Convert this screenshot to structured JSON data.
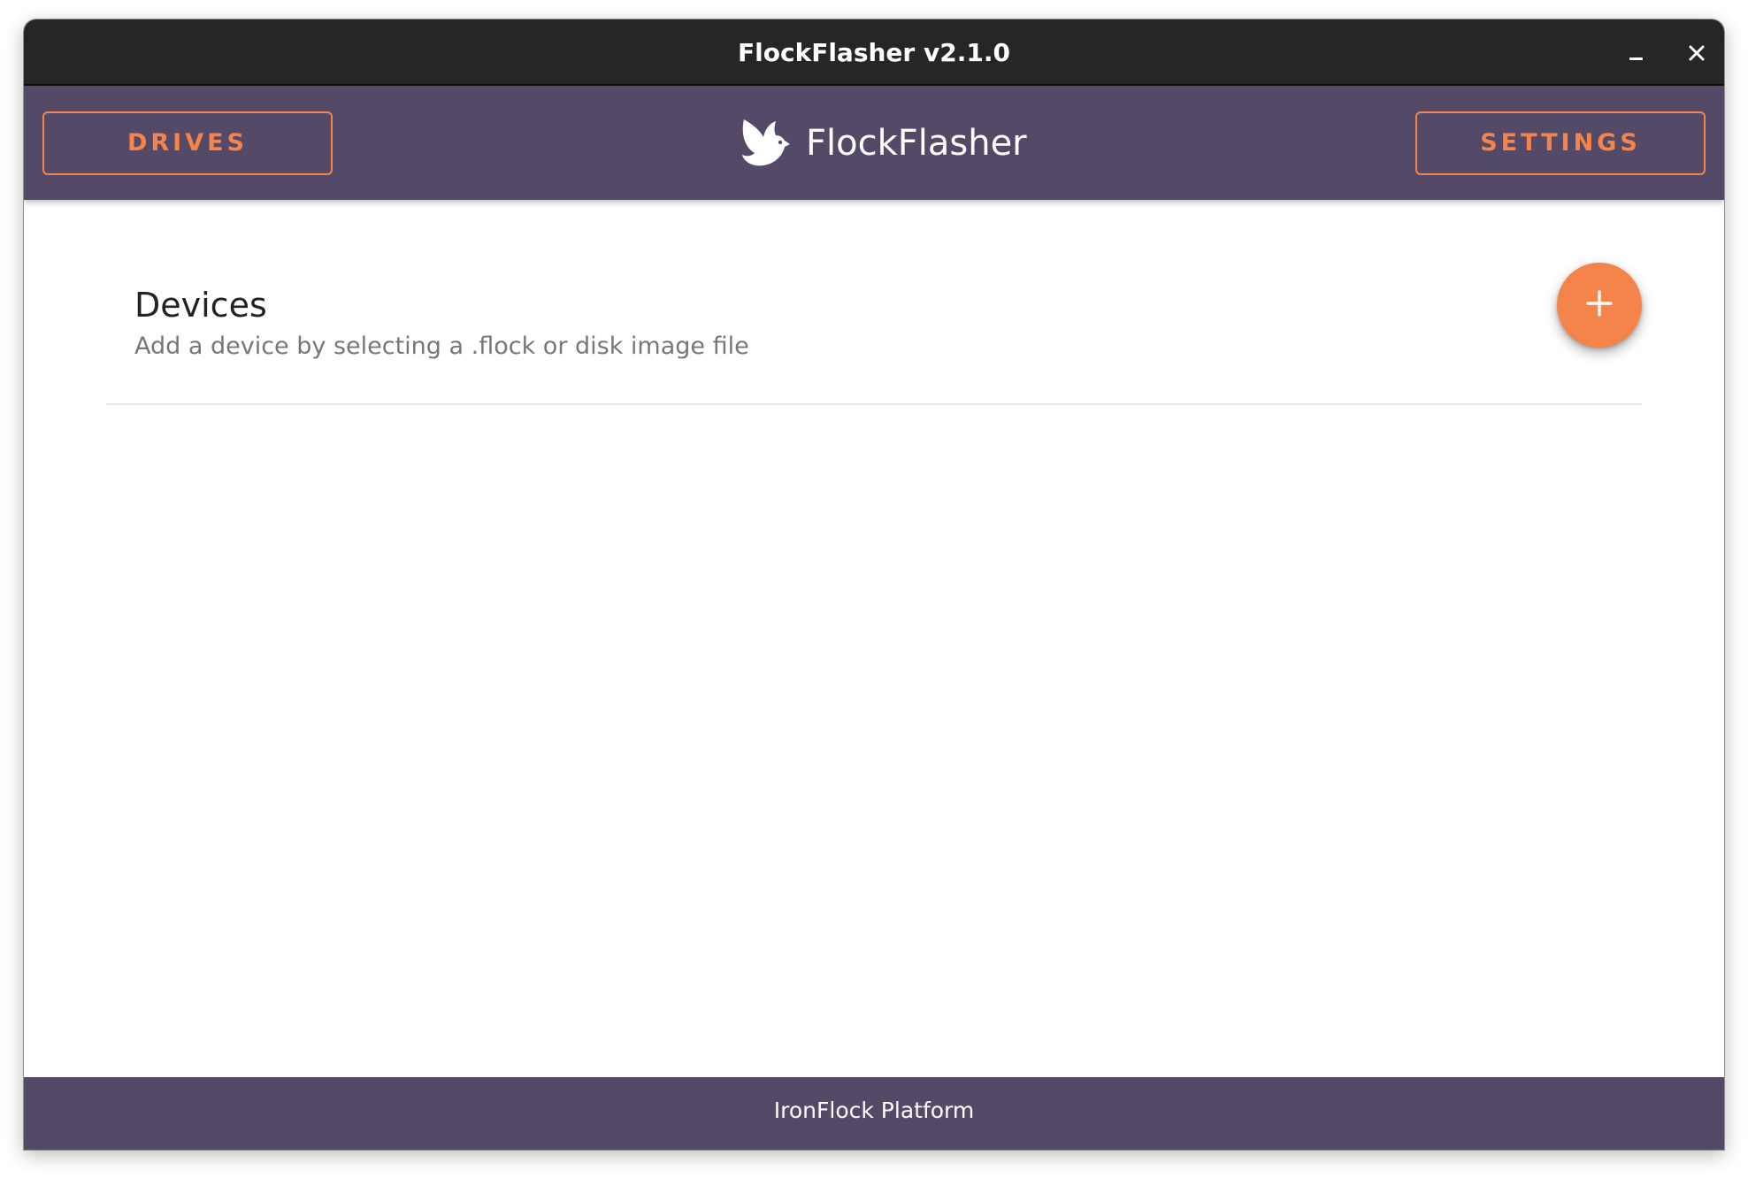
{
  "window": {
    "title": "FlockFlasher v2.1.0",
    "minimize_icon": "minimize-icon",
    "close_icon": "close-icon"
  },
  "header": {
    "drives_label": "DRIVES",
    "settings_label": "SETTINGS",
    "app_name": "FlockFlasher",
    "logo_icon": "bird-logo-icon"
  },
  "main": {
    "section_title": "Devices",
    "section_subtitle": "Add a device by selecting a .flock or disk image file",
    "add_icon": "plus-icon"
  },
  "footer": {
    "text": "IronFlock Platform"
  },
  "colors": {
    "accent": "#f5844a",
    "header_bg": "#544a68",
    "titlebar_bg": "#262626"
  }
}
